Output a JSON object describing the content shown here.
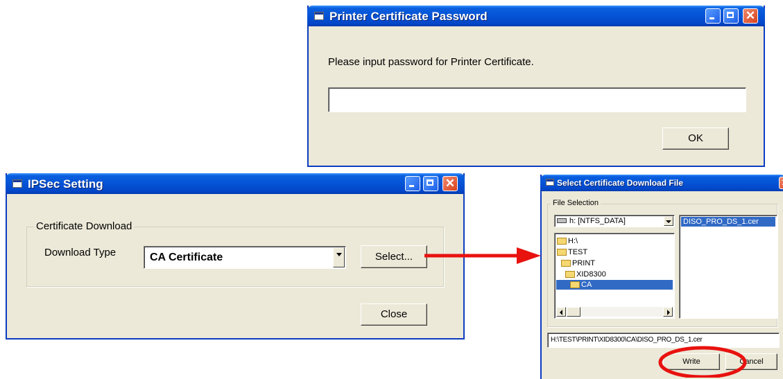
{
  "password_dialog": {
    "title": "Printer Certificate Password",
    "prompt": "Please input password for Printer Certificate.",
    "password_value": "",
    "ok_label": "OK"
  },
  "ipsec_dialog": {
    "title": "IPSec Setting",
    "group_label": "Certificate Download",
    "download_type_label": "Download Type",
    "download_type_value": "CA Certificate",
    "select_label": "Select...",
    "close_label": "Close"
  },
  "file_dialog": {
    "title": "Select Certificate Download File",
    "group_label": "File Selection",
    "drive_value": "h: [NTFS_DATA]",
    "folders": [
      "H:\\",
      "TEST",
      "PRINT",
      "XID8300",
      "CA"
    ],
    "selected_folder": "CA",
    "files": [
      "DISO_PRO_DS_1.cer"
    ],
    "path_value": "H:\\TEST\\PRINT\\XID8300\\CA\\DISO_PRO_DS_1.cer",
    "write_label": "Write",
    "cancel_label": "Cancel"
  },
  "colors": {
    "arrow": "#e8120f",
    "highlight_circle": "#e8120f",
    "titlebar": "#0553d6",
    "dialog_bg": "#ece9d8"
  },
  "icons": [
    "window-icon",
    "minimize-icon",
    "maximize-icon",
    "close-icon",
    "dropdown-arrow-icon",
    "drive-icon",
    "folder-icon"
  ]
}
